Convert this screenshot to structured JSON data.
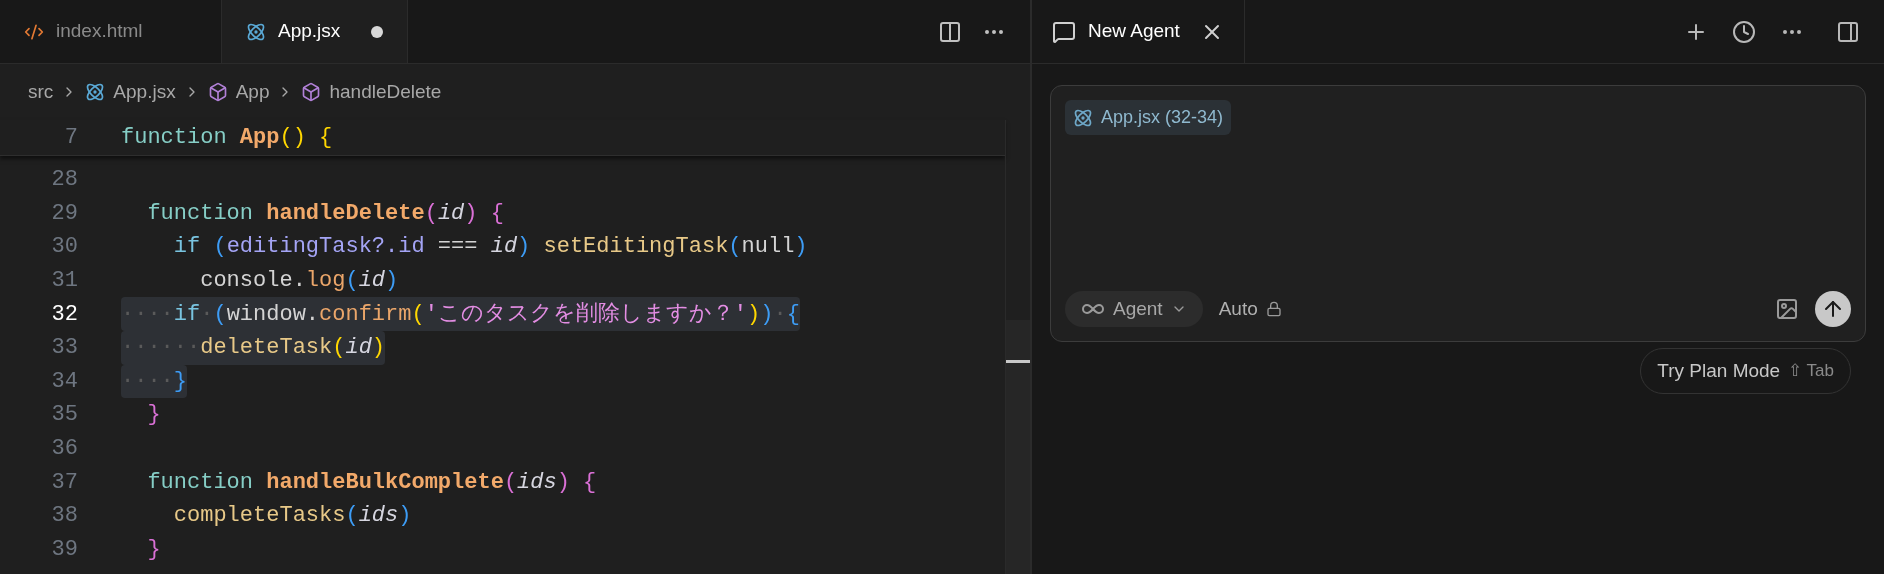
{
  "editor": {
    "tabs": [
      {
        "label": "index.html",
        "kind": "html",
        "selected": false,
        "modified": false
      },
      {
        "label": "App.jsx",
        "kind": "react",
        "selected": true,
        "modified": true
      }
    ],
    "breadcrumbs": [
      {
        "label": "src",
        "kind": "folder"
      },
      {
        "label": "App.jsx",
        "kind": "react"
      },
      {
        "label": "App",
        "kind": "symbol"
      },
      {
        "label": "handleDelete",
        "kind": "symbol"
      }
    ],
    "sticky_line": {
      "number": "7",
      "tokens": [
        {
          "kind": "kw",
          "text": "function "
        },
        {
          "kind": "fndef",
          "text": "App"
        },
        {
          "kind": "b1",
          "text": "() {"
        }
      ]
    },
    "lines": [
      {
        "number": "28",
        "current": false,
        "selected": false
      },
      {
        "number": "29",
        "current": false,
        "selected": false,
        "tokens": [
          {
            "kind": "kw",
            "text": "  function "
          },
          {
            "kind": "fndef",
            "text": "handleDelete"
          },
          {
            "kind": "b2",
            "text": "("
          },
          {
            "kind": "param",
            "text": "id"
          },
          {
            "kind": "b2",
            "text": ") {"
          }
        ]
      },
      {
        "number": "30",
        "current": false,
        "selected": false,
        "tokens": [
          {
            "kind": "ctrl",
            "text": "    if "
          },
          {
            "kind": "b3",
            "text": "("
          },
          {
            "kind": "prop",
            "text": "editingTask?.id"
          },
          {
            "kind": "plain",
            "text": " === "
          },
          {
            "kind": "param",
            "text": "id"
          },
          {
            "kind": "b3",
            "text": ") "
          },
          {
            "kind": "call2",
            "text": "setEditingTask"
          },
          {
            "kind": "b3",
            "text": "("
          },
          {
            "kind": "plain",
            "text": "null"
          },
          {
            "kind": "b3",
            "text": ")"
          }
        ]
      },
      {
        "number": "31",
        "current": false,
        "selected": false,
        "tokens": [
          {
            "kind": "plain",
            "text": "      console."
          },
          {
            "kind": "call",
            "text": "log"
          },
          {
            "kind": "b3",
            "text": "("
          },
          {
            "kind": "param",
            "text": "id"
          },
          {
            "kind": "b3",
            "text": ")"
          }
        ]
      },
      {
        "number": "32",
        "current": true,
        "selected": true,
        "tokens": [
          {
            "kind": "ws",
            "text": "····"
          },
          {
            "kind": "ctrl",
            "text": "if"
          },
          {
            "kind": "ws",
            "text": "·"
          },
          {
            "kind": "b3",
            "text": "("
          },
          {
            "kind": "plain",
            "text": "window."
          },
          {
            "kind": "call",
            "text": "confirm"
          },
          {
            "kind": "b1",
            "text": "("
          },
          {
            "kind": "string",
            "text": "'このタスクを削除しますか？'"
          },
          {
            "kind": "b1",
            "text": ")"
          },
          {
            "kind": "b3",
            "text": ")"
          },
          {
            "kind": "ws",
            "text": "·"
          },
          {
            "kind": "b3",
            "text": "{"
          }
        ]
      },
      {
        "number": "33",
        "current": false,
        "selected": true,
        "tokens": [
          {
            "kind": "ws",
            "text": "······"
          },
          {
            "kind": "call2",
            "text": "deleteTask"
          },
          {
            "kind": "b1",
            "text": "("
          },
          {
            "kind": "param",
            "text": "id"
          },
          {
            "kind": "b1",
            "text": ")"
          }
        ]
      },
      {
        "number": "34",
        "current": false,
        "selected": true,
        "tokens": [
          {
            "kind": "ws",
            "text": "····"
          },
          {
            "kind": "b3",
            "text": "}"
          }
        ]
      },
      {
        "number": "35",
        "current": false,
        "selected": false,
        "tokens": [
          {
            "kind": "b2",
            "text": "  }"
          }
        ]
      },
      {
        "number": "36",
        "current": false,
        "selected": false
      },
      {
        "number": "37",
        "current": false,
        "selected": false,
        "tokens": [
          {
            "kind": "kw",
            "text": "  function "
          },
          {
            "kind": "fndef",
            "text": "handleBulkComplete"
          },
          {
            "kind": "b2",
            "text": "("
          },
          {
            "kind": "param",
            "text": "ids"
          },
          {
            "kind": "b2",
            "text": ") {"
          }
        ]
      },
      {
        "number": "38",
        "current": false,
        "selected": false,
        "tokens": [
          {
            "kind": "call2",
            "text": "    completeTasks"
          },
          {
            "kind": "b3",
            "text": "("
          },
          {
            "kind": "param",
            "text": "ids"
          },
          {
            "kind": "b3",
            "text": ")"
          }
        ]
      },
      {
        "number": "39",
        "current": false,
        "selected": false,
        "tokens": [
          {
            "kind": "b2",
            "text": "  }"
          }
        ]
      }
    ]
  },
  "agent_panel": {
    "tab": {
      "label": "New Agent"
    },
    "context_chip": "App.jsx (32-34)",
    "mode": "Agent",
    "model": "Auto",
    "hint": {
      "label": "Try Plan Mode",
      "key_symbol": "⇧",
      "key": "Tab"
    }
  }
}
